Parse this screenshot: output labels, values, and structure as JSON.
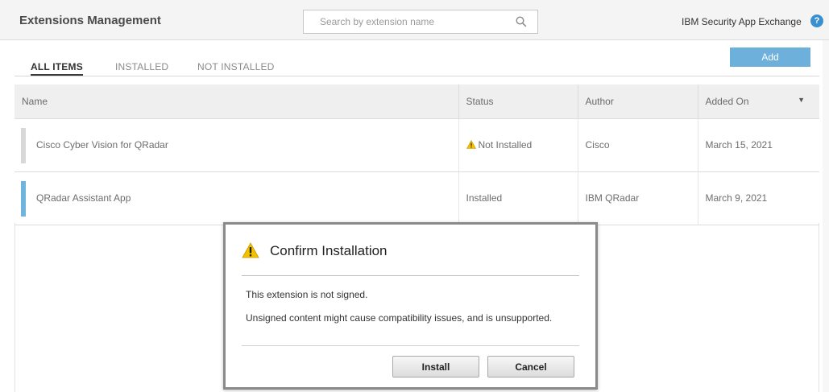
{
  "header": {
    "title": "Extensions Management",
    "search_placeholder": "Search by extension name",
    "exchange_link": "IBM Security App Exchange",
    "help_label": "?"
  },
  "tabs": [
    {
      "label": "ALL ITEMS",
      "active": true
    },
    {
      "label": "INSTALLED",
      "active": false
    },
    {
      "label": "NOT INSTALLED",
      "active": false
    }
  ],
  "add_button": "Add",
  "table": {
    "columns": [
      "Name",
      "Status",
      "Author",
      "Added On"
    ],
    "rows": [
      {
        "name": "Cisco Cyber Vision for QRadar",
        "status": "Not Installed",
        "author": "Cisco",
        "added_on": "March 15, 2021",
        "installed": false
      },
      {
        "name": "QRadar Assistant App",
        "status": "Installed",
        "author": "IBM QRadar",
        "added_on": "March 9, 2021",
        "installed": true
      }
    ]
  },
  "modal": {
    "title": "Confirm Installation",
    "message_1": "This extension is not signed.",
    "message_2": "Unsigned content might cause compatibility issues, and is unsupported.",
    "install_label": "Install",
    "cancel_label": "Cancel"
  },
  "colors": {
    "accent": "#6eb0dc",
    "installed_bar": "#6fb4dc",
    "not_installed_bar": "#d8d8d8",
    "warning": "#f2c200"
  },
  "icons": {
    "search": "search-icon",
    "help": "help-icon",
    "warning": "warning-icon",
    "sort": "sort-down-icon"
  }
}
